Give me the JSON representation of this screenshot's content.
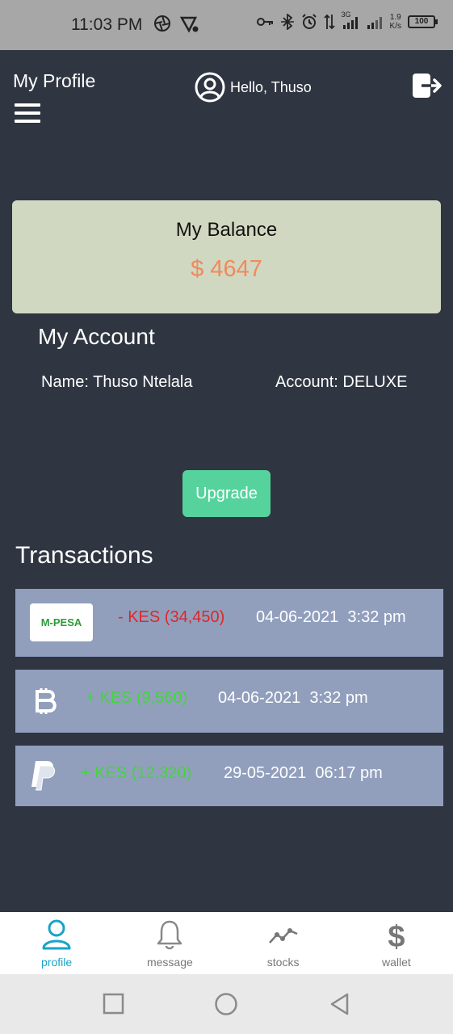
{
  "status_bar": {
    "time": "11:03 PM",
    "network": "3G",
    "speed_value": "1.9",
    "speed_unit": "K/s",
    "battery": "100"
  },
  "header": {
    "title": "My Profile",
    "greeting": "Hello, Thuso"
  },
  "balance": {
    "title": "My Balance",
    "amount": "$ 4647"
  },
  "account": {
    "title": "My Account",
    "name": "Name: Thuso Ntelala",
    "type": "Account: DELUXE"
  },
  "upgrade_label": "Upgrade",
  "transactions": {
    "title": "Transactions",
    "items": [
      {
        "source": "mpesa",
        "logo_text": "M-PESA",
        "amount": "- KES (34,450)",
        "datetime": "04-06-2021  3:32 pm",
        "direction": "out"
      },
      {
        "source": "bitcoin",
        "amount": "+ KES (9,560)",
        "datetime": "04-06-2021  3:32 pm",
        "direction": "in"
      },
      {
        "source": "paypal",
        "amount": "+ KES (12,320)",
        "datetime": "29-05-2021  06:17 pm",
        "direction": "in"
      }
    ]
  },
  "bottom_nav": [
    {
      "label": "profile",
      "icon": "user-icon",
      "active": true
    },
    {
      "label": "message",
      "icon": "bell-icon",
      "active": false
    },
    {
      "label": "stocks",
      "icon": "stocks-icon",
      "active": false
    },
    {
      "label": "wallet",
      "icon": "dollar-icon",
      "active": false
    }
  ],
  "colors": {
    "background": "#2f3541",
    "balance_card": "#d0d8c1",
    "balance_amount": "#f08a5d",
    "upgrade_button": "#56d39d",
    "transaction_row": "#919fbd",
    "negative": "#e02626",
    "positive": "#43d63b",
    "nav_active": "#1aa3c8"
  }
}
